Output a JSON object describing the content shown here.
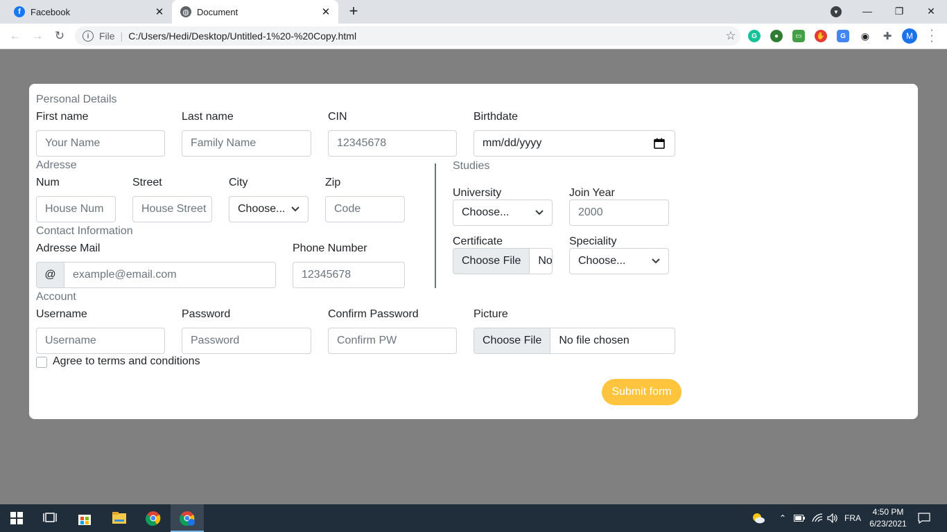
{
  "browser": {
    "tabs": [
      {
        "title": "Facebook",
        "active": false,
        "favicon": "facebook-icon"
      },
      {
        "title": "Document",
        "active": true,
        "favicon": "globe-icon"
      }
    ],
    "omnibox": {
      "scheme_label": "File",
      "url": "C:/Users/Hedi/Desktop/Untitled-1%20-%20Copy.html"
    },
    "profile_initial": "M",
    "extensions": [
      "grammarly-icon",
      "globe-extension-icon",
      "tab-extension-icon",
      "stop-extension-icon",
      "translate-icon",
      "eye-extension-icon",
      "puzzle-icon"
    ]
  },
  "form": {
    "personal": {
      "legend": "Personal Details",
      "first_name": {
        "label": "First name",
        "placeholder": "Your Name"
      },
      "last_name": {
        "label": "Last name",
        "placeholder": "Family Name"
      },
      "cin": {
        "label": "CIN",
        "placeholder": "12345678"
      },
      "birthdate": {
        "label": "Birthdate",
        "value": "mm/dd/yyyy"
      }
    },
    "address": {
      "legend": "Adresse",
      "num": {
        "label": "Num",
        "placeholder": "House Num"
      },
      "street": {
        "label": "Street",
        "placeholder": "House Street"
      },
      "city": {
        "label": "City",
        "value": "Choose..."
      },
      "zip": {
        "label": "Zip",
        "placeholder": "Code"
      }
    },
    "contact": {
      "legend": "Contact Information",
      "email": {
        "label": "Adresse Mail",
        "addon": "@",
        "placeholder": "example@email.com"
      },
      "phone": {
        "label": "Phone Number",
        "placeholder": "12345678"
      }
    },
    "studies": {
      "legend": "Studies",
      "university": {
        "label": "University",
        "value": "Choose..."
      },
      "join_year": {
        "label": "Join Year",
        "placeholder": "2000"
      },
      "certificate": {
        "label": "Certificate",
        "button": "Choose File",
        "status": "No"
      },
      "speciality": {
        "label": "Speciality",
        "value": "Choose..."
      }
    },
    "account": {
      "legend": "Account",
      "username": {
        "label": "Username",
        "placeholder": "Username"
      },
      "password": {
        "label": "Password",
        "placeholder": "Password"
      },
      "confirm": {
        "label": "Confirm Password",
        "placeholder": "Confirm PW"
      },
      "picture": {
        "label": "Picture",
        "button": "Choose File",
        "status": "No file chosen"
      }
    },
    "terms_label": "Agree to terms and conditions",
    "submit_label": "Submit form",
    "submit_color": "#ffc43d"
  },
  "taskbar": {
    "language": "FRA",
    "time": "4:50 PM",
    "date": "6/23/2021"
  }
}
